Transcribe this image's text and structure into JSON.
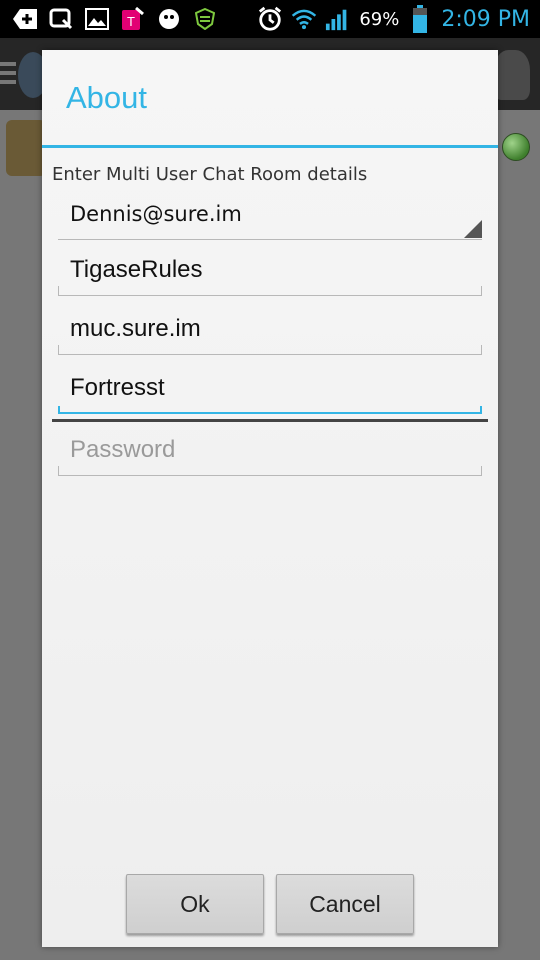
{
  "status_bar": {
    "battery_percent": "69%",
    "time": "2:09 PM",
    "icons": [
      "add-icon",
      "quick-memo-icon",
      "gallery-icon",
      "tmobile-icon",
      "game-icon",
      "shield-icon",
      "alarm-icon",
      "wifi-icon",
      "signal-icon",
      "battery-icon"
    ]
  },
  "dialog": {
    "title": "About",
    "instructions": "Enter Multi User Chat Room details",
    "account": {
      "selected": "Dennis@sure.im"
    },
    "room_name": {
      "value": "TigaseRules"
    },
    "server": {
      "value": "muc.sure.im"
    },
    "nickname": {
      "value": "Fortresst"
    },
    "password": {
      "value": "",
      "placeholder": "Password"
    },
    "buttons": {
      "ok": "Ok",
      "cancel": "Cancel"
    }
  },
  "colors": {
    "accent": "#33b5e5",
    "status_dot": "#3f7f2d"
  }
}
